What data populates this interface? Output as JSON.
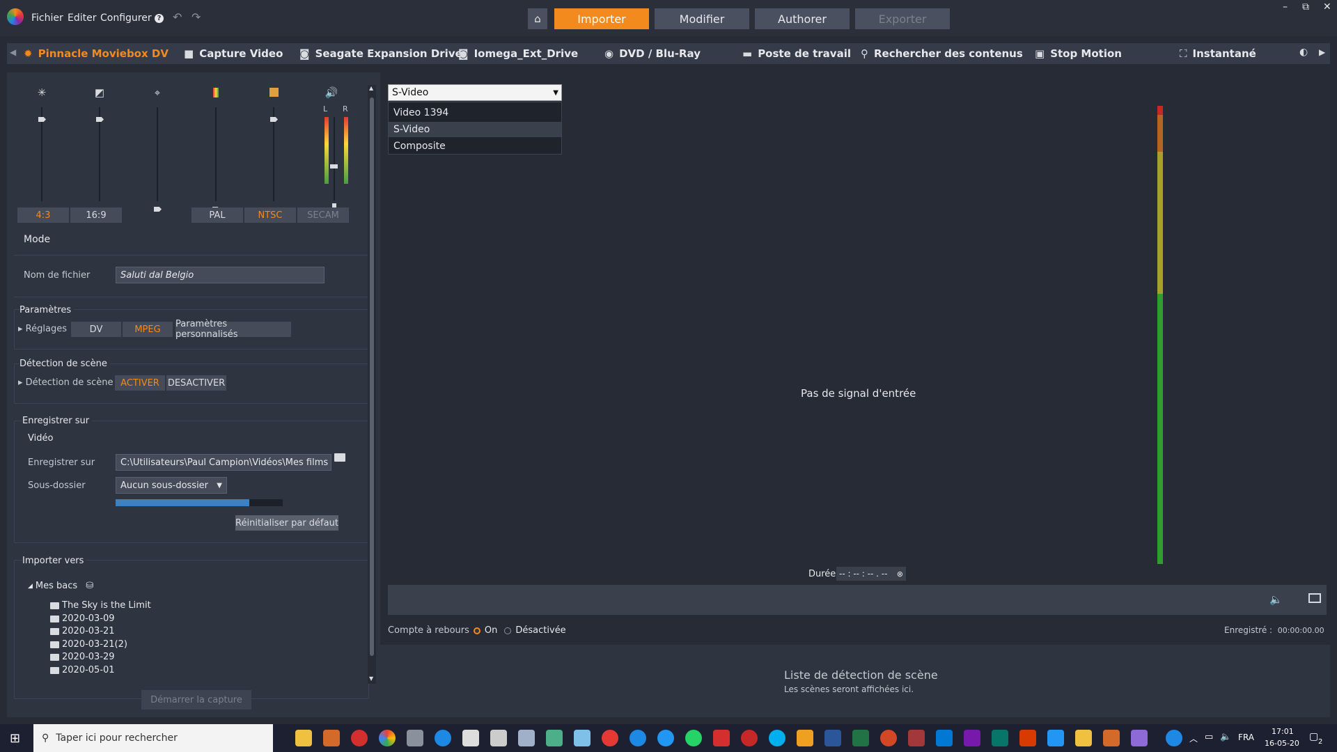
{
  "menu": {
    "fichier": "Fichier",
    "editer": "Editer",
    "configurer": "Configurer",
    "help": "?"
  },
  "topnav": {
    "importer": "Importer",
    "modifier": "Modifier",
    "authorer": "Authorer",
    "exporter": "Exporter"
  },
  "window_controls": {
    "minimize": "–",
    "restore": "⧉",
    "close": "✕"
  },
  "sources": [
    {
      "label": "Pinnacle Moviebox DV",
      "icon": "gear-icon"
    },
    {
      "label": "Capture Video",
      "icon": "camcorder-icon"
    },
    {
      "label": "Seagate Expansion Drive",
      "icon": "camera-icon"
    },
    {
      "label": "Iomega_Ext_Drive",
      "icon": "camera-icon"
    },
    {
      "label": "DVD / Blu-Ray",
      "icon": "disc-icon"
    },
    {
      "label": "Poste de travail",
      "icon": "folder-icon"
    },
    {
      "label": "Rechercher des contenus",
      "icon": "search-icon"
    },
    {
      "label": "Stop Motion",
      "icon": "stopmotion-icon"
    },
    {
      "label": "Instantané",
      "icon": "snapshot-icon"
    }
  ],
  "sliders": {
    "vu_l": "L",
    "vu_r": "R"
  },
  "aspect": {
    "a43": "4:3",
    "a169": "16:9"
  },
  "tvstd": {
    "pal": "PAL",
    "ntsc": "NTSC",
    "secam": "SECAM"
  },
  "mode": {
    "title": "Mode",
    "filename_label": "Nom de fichier",
    "filename_value": "Saluti dal Belgio"
  },
  "params": {
    "title": "Paramètres",
    "reglages": "Réglages",
    "dv": "DV",
    "mpeg": "MPEG",
    "custom": "Paramètres personnalisés"
  },
  "scene": {
    "title": "Détection de scène",
    "label": "Détection de scène",
    "on": "ACTIVER",
    "off": "DESACTIVER"
  },
  "save": {
    "title": "Enregistrer sur",
    "video": "Vidéo",
    "path_label": "Enregistrer sur",
    "path_value": "C:\\Utilisateurs\\Paul Campion\\Vidéos\\Mes films",
    "subfolder_label": "Sous-dossier",
    "subfolder_value": "Aucun sous-dossier",
    "progress": 0.8,
    "reset": "Réinitialiser par défaut"
  },
  "import_to": {
    "title": "Importer vers",
    "root": "Mes bacs",
    "items": [
      "The Sky is the Limit",
      "2020-03-09",
      "2020-03-21",
      "2020-03-21(2)",
      "2020-03-29",
      "2020-05-01"
    ]
  },
  "start_capture": "Démarrer la capture",
  "input_select": {
    "value": "S-Video",
    "options": [
      "Video 1394",
      "S-Video",
      "Composite"
    ]
  },
  "preview": {
    "no_signal": "Pas de signal d'entrée",
    "duree_label": "Durée",
    "duree_value": "-- : -- : -- . --"
  },
  "countdown": {
    "label": "Compte à rebours",
    "on": "On",
    "off": "Désactivée"
  },
  "recorded": {
    "label": "Enregistré :",
    "value": "00:00:00.00"
  },
  "scene_list": {
    "title": "Liste de détection de scène",
    "subtitle": "Les scènes seront affichées ici."
  },
  "taskbar": {
    "search_placeholder": "Taper ici pour rechercher",
    "lang": "FRA",
    "time": "17:01",
    "date": "16-05-20",
    "notif": "2"
  }
}
